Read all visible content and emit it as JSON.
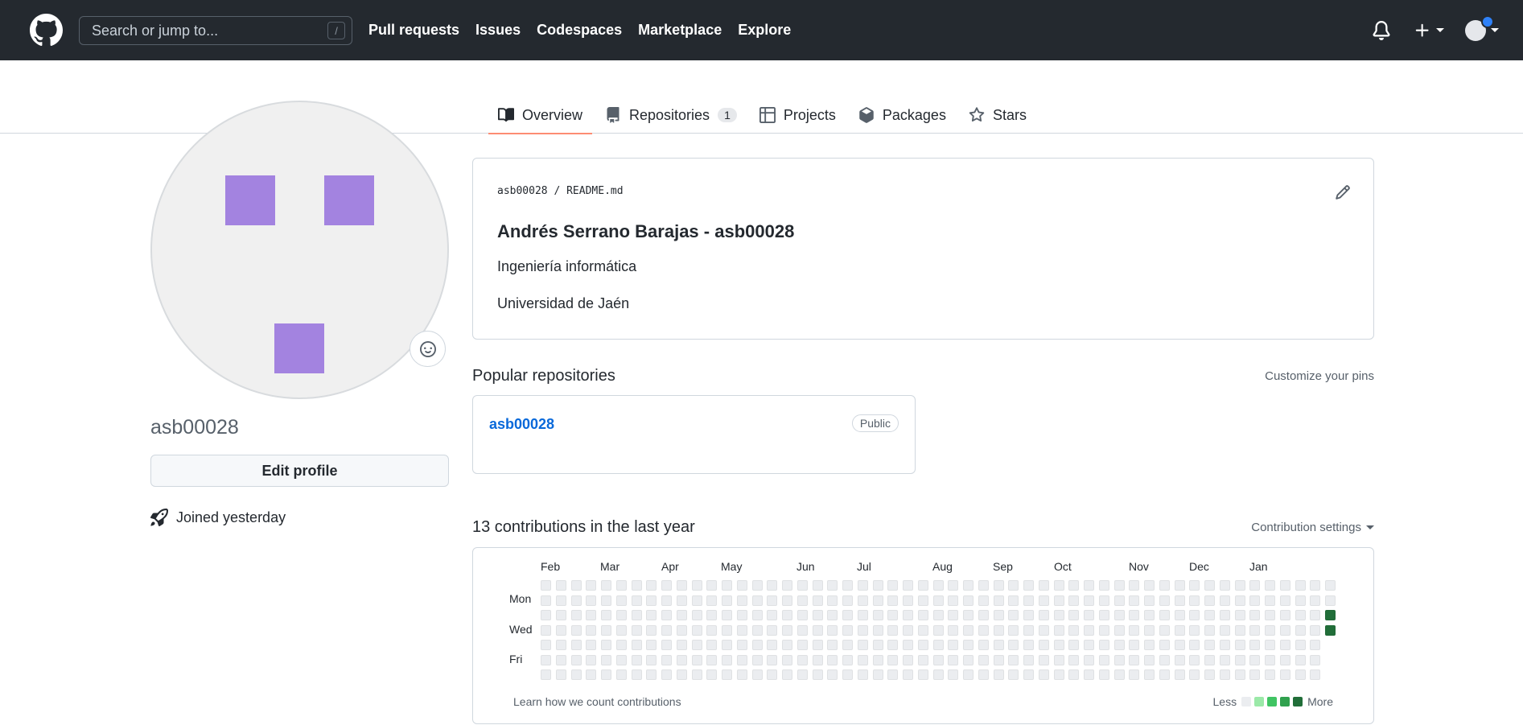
{
  "header": {
    "search_placeholder": "Search or jump to...",
    "search_shortcut": "/",
    "nav": [
      "Pull requests",
      "Issues",
      "Codespaces",
      "Marketplace",
      "Explore"
    ],
    "colors": {
      "bg": "#24292f",
      "avatar_dot": "#2f81f7"
    }
  },
  "tabs": [
    {
      "label": "Overview",
      "icon": "book-icon",
      "active": true
    },
    {
      "label": "Repositories",
      "icon": "repo-icon",
      "counter": "1"
    },
    {
      "label": "Projects",
      "icon": "table-icon"
    },
    {
      "label": "Packages",
      "icon": "package-icon"
    },
    {
      "label": "Stars",
      "icon": "star-icon"
    }
  ],
  "profile": {
    "username": "asb00028",
    "edit_label": "Edit profile",
    "joined": "Joined yesterday",
    "identicon_color": "#a383e0"
  },
  "readme": {
    "owner": "asb00028",
    "separator": "/",
    "file": "README.md",
    "title": "Andrés Serrano Barajas - asb00028",
    "lines": [
      "Ingeniería informática",
      "Universidad de Jaén"
    ]
  },
  "popular": {
    "title": "Popular repositories",
    "customize": "Customize your pins",
    "repos": [
      {
        "name": "asb00028",
        "visibility": "Public"
      }
    ]
  },
  "contributions": {
    "title": "13 contributions in the last year",
    "settings": "Contribution settings",
    "months": [
      "Feb",
      "Mar",
      "Apr",
      "May",
      "Jun",
      "Jul",
      "Aug",
      "Sep",
      "Oct",
      "Nov",
      "Dec",
      "Jan"
    ],
    "days": [
      "Mon",
      "Wed",
      "Fri"
    ],
    "learn": "Learn how we count contributions",
    "legend_less": "Less",
    "legend_more": "More",
    "legend_colors": [
      "#ebedf0",
      "#9be9a8",
      "#40c463",
      "#30a14e",
      "#216e39"
    ],
    "active_color": "#216e39",
    "weeks": 53,
    "active_cells": [
      {
        "week": 52,
        "day": 2
      },
      {
        "week": 52,
        "day": 3
      }
    ]
  }
}
